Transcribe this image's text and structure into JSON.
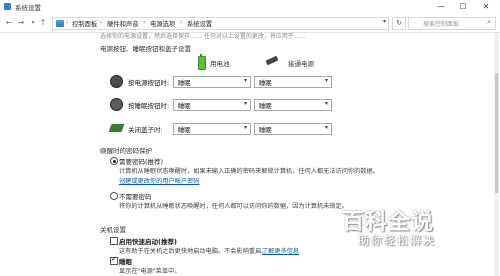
{
  "window": {
    "title": "系统设置",
    "controls": {
      "minimize": "—",
      "maximize": "☐",
      "close": "✕"
    }
  },
  "addressbar": {
    "back": "←",
    "forward": "→",
    "up": "↑",
    "breadcrumbs": [
      "控制面板",
      "硬件和声音",
      "电源选项",
      "系统设置"
    ],
    "separator": "›",
    "dropdown": "▾",
    "refresh": "↻",
    "search_placeholder": "搜索控制面板",
    "search_icon": "⌕"
  },
  "content": {
    "cut_off_text": "选择你的电源设置，然后选择保存…… 任何对以上设置的更改，将应用于……",
    "section_power": "电源按钮、睡眠按钮和盖子设置",
    "col_battery": "用电池",
    "col_plugged": "接通电源",
    "rows": [
      {
        "label": "按电源按钮时:",
        "battery": "睡眠",
        "plugged": "睡眠",
        "icon": "power-icon"
      },
      {
        "label": "按睡眠按钮时:",
        "battery": "睡眠",
        "plugged": "睡眠",
        "icon": "sleep-icon"
      },
      {
        "label": "关闭盖子时:",
        "battery": "睡眠",
        "plugged": "睡眠",
        "icon": "lid-icon"
      }
    ],
    "section_wake": "唤醒时的密码保护",
    "opt_require": "需要密码(推荐)",
    "opt_require_desc": "计算机从睡眠状态唤醒时，如果未输入正确的密码来解锁计算机，任何人都无法访问你的数据。",
    "opt_require_link": "创建或更改你的用户帐户密码",
    "opt_no_require": "不需要密码",
    "opt_no_require_desc": "将你的计算机从睡眠状态唤醒时，任何人都可以访问你的数据，因为计算机未锁定。",
    "section_shutdown": "关机设置",
    "fast_startup": "启用快速启动(推荐)",
    "fast_startup_desc": "这有助于在关机之后更快地启动电脑。不会影响重启。",
    "fast_startup_link": "了解更多信息",
    "sleep_label": "睡眠",
    "sleep_desc": "显示在\"电源\"菜单中。"
  },
  "watermark": {
    "logo": "百科全说",
    "sub": "助你轻松解决"
  },
  "colors": {
    "link": "#0b5bb5",
    "battery": "#5bbf3a"
  }
}
